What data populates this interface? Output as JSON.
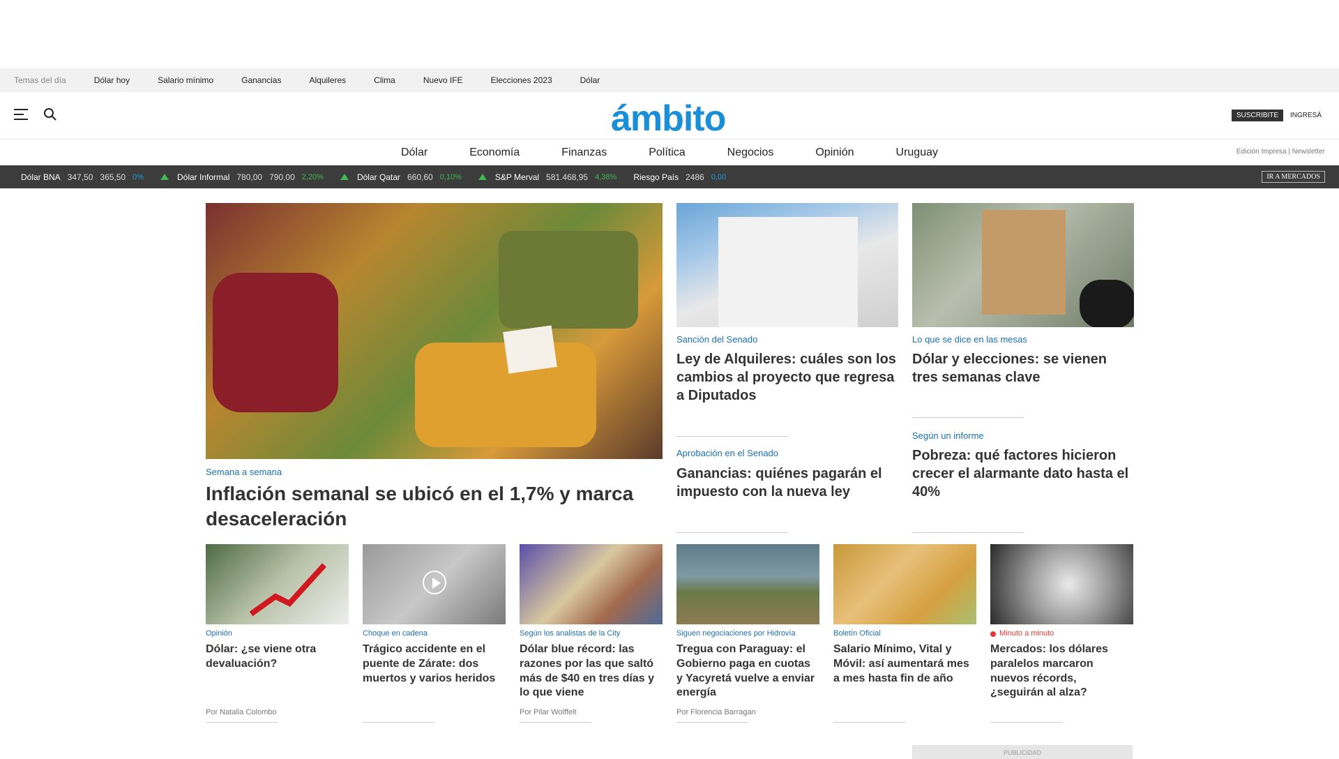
{
  "topics": {
    "label": "Temas del día",
    "items": [
      "Dólar hoy",
      "Salario mínimo",
      "Ganancias",
      "Alquileres",
      "Clima",
      "Nuevo IFE",
      "Elecciones 2023",
      "Dólar"
    ]
  },
  "header": {
    "logo": "ámbito",
    "subscribe": "SUSCRIBITE",
    "login": "INGRESÁ"
  },
  "nav": {
    "items": [
      "Dólar",
      "Economía",
      "Finanzas",
      "Política",
      "Negocios",
      "Opinión",
      "Uruguay"
    ],
    "print_edition": "Edición Impresa",
    "newsletter": "Newsletter"
  },
  "ticker": {
    "items": [
      {
        "name": "Dólar BNA",
        "v1": "347,50",
        "v2": "365,50",
        "change": "0%",
        "arrow": false,
        "color": "#1a9cd8"
      },
      {
        "name": "Dólar Informal",
        "v1": "780,00",
        "v2": "790,00",
        "change": "2,20%",
        "arrow": true,
        "color": "#3fb950"
      },
      {
        "name": "Dólar Qatar",
        "v1": "660,60",
        "v2": "",
        "change": "0,10%",
        "arrow": true,
        "color": "#3fb950"
      },
      {
        "name": "S&P Merval",
        "v1": "581.468,95",
        "v2": "",
        "change": "4,38%",
        "arrow": true,
        "color": "#3fb950"
      },
      {
        "name": "Riesgo País",
        "v1": "2486",
        "v2": "",
        "change": "0,00",
        "arrow": false,
        "color": "#1a9cd8"
      }
    ],
    "markets_button": "IR A MERCADOS"
  },
  "lead": {
    "kicker": "Semana a semana",
    "title": "Inflación semanal se ubicó en el 1,7% y marca desaceleración"
  },
  "col2": [
    {
      "kicker": "Sanción del Senado",
      "title": "Ley de Alquileres: cuáles son los cambios al proyecto que regresa a Diputados"
    },
    {
      "kicker": "Aprobación en el Senado",
      "title": "Ganancias: quiénes pagarán el impuesto con la nueva ley"
    }
  ],
  "col3": [
    {
      "kicker": "Lo que se dice en las mesas",
      "title": "Dólar y elecciones: se vienen tres semanas clave"
    },
    {
      "kicker": "Según un informe",
      "title": "Pobreza: qué factores hicieron crecer el alarmante dato hasta el 40%"
    }
  ],
  "row": [
    {
      "kicker": "Opinión",
      "title": "Dólar: ¿se viene otra devaluación?",
      "author": "Por Natalia Colombo"
    },
    {
      "kicker": "Choque en cadena",
      "title": "Trágico accidente en el puente de Zárate: dos muertos y varios heridos",
      "author": ""
    },
    {
      "kicker": "Según los analistas de la City",
      "title": "Dólar blue récord: las razones por las que saltó más de $40 en tres días y lo que viene",
      "author": "Por Pilar Wolffelt"
    },
    {
      "kicker": "Siguen negociaciones por Hidrovía",
      "title": "Tregua con Paraguay: el Gobierno paga en cuotas y Yacyretá vuelve a enviar energía",
      "author": "Por Florencia Barragan"
    },
    {
      "kicker": "Boletín Oficial",
      "title": "Salario Mínimo, Vital y Móvil: así aumentará mes a mes hasta fin de año",
      "author": ""
    },
    {
      "kicker": "Minuto a minuto",
      "title": "Mercados: los dólares paralelos marcaron nuevos récords, ¿seguirán al alza?",
      "author": ""
    }
  ],
  "publicidad": "PUBLICIDAD"
}
